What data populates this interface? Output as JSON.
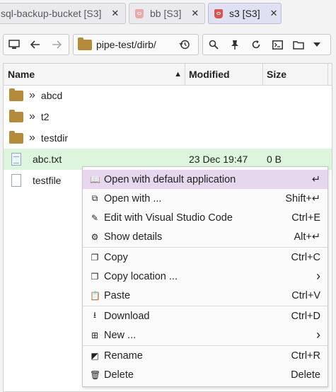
{
  "tabs": [
    {
      "label": "sql-backup-bucket [S3]",
      "active": false,
      "closable": true
    },
    {
      "label": "bb [S3]",
      "active": false,
      "closable": true
    },
    {
      "label": "s3 [S3]",
      "active": true,
      "closable": true
    }
  ],
  "tab_close_glyph": "✕",
  "toolbar": {
    "path": "pipe-test/dirb/",
    "icons": [
      "computer-icon",
      "back-arrow-icon",
      "forward-arrow-icon",
      "history-icon",
      "search-icon",
      "pin-icon",
      "refresh-icon",
      "terminal-icon",
      "folder-icon",
      "dropdown-arrow-icon"
    ]
  },
  "columns": {
    "name": "Name",
    "modified": "Modified",
    "size": "Size",
    "sort_indicator": "▲"
  },
  "rows": [
    {
      "name": "abcd",
      "type": "folder",
      "modified": "",
      "size": ""
    },
    {
      "name": "t2",
      "type": "folder",
      "modified": "",
      "size": ""
    },
    {
      "name": "testdir",
      "type": "folder",
      "modified": "",
      "size": ""
    },
    {
      "name": "abc.txt",
      "type": "text-file",
      "modified": "23 Dec 19:47",
      "size": "0 B",
      "selected": true
    },
    {
      "name": "testfile",
      "type": "file",
      "modified": "",
      "size": ""
    }
  ],
  "folder_chevron": "»",
  "context_menu": {
    "items": [
      {
        "label": "Open with default application",
        "shortcut": "↵",
        "icon": "open-book-icon",
        "glyph": "📖",
        "highlighted": true
      },
      {
        "label": "Open with ...",
        "shortcut": "Shift+↵",
        "icon": "open-with-icon",
        "glyph": "⧉"
      },
      {
        "label": "Edit with Visual Studio Code",
        "shortcut": "Ctrl+E",
        "icon": "pencil-icon",
        "glyph": "✎"
      },
      {
        "label": "Show details",
        "shortcut": "Alt+↵",
        "icon": "details-icon",
        "glyph": "⚙"
      },
      {
        "label": "Copy",
        "shortcut": "Ctrl+C",
        "icon": "copy-icon",
        "glyph": "❐"
      },
      {
        "label": "Copy location ...",
        "shortcut": "›",
        "icon": "copy-location-icon",
        "glyph": "❐"
      },
      {
        "label": "Paste",
        "shortcut": "Ctrl+V",
        "icon": "paste-icon",
        "glyph": "📋"
      },
      {
        "label": "Download",
        "shortcut": "Ctrl+D",
        "icon": "download-icon",
        "glyph": "⭳"
      },
      {
        "label": "New ...",
        "shortcut": "›",
        "icon": "new-icon",
        "glyph": "⊞"
      },
      {
        "label": "Rename",
        "shortcut": "Ctrl+R",
        "icon": "rename-icon",
        "glyph": "◩"
      },
      {
        "label": "Delete",
        "shortcut": "Delete",
        "icon": "trash-icon",
        "glyph": "🗑"
      }
    ]
  },
  "colors": {
    "selected_row": "#ddf5dd",
    "menu_highlight": "#e6d6ee",
    "folder": "#b58a3a",
    "s3_icon": "#d9534f",
    "active_tab": "#dfe0f2"
  }
}
